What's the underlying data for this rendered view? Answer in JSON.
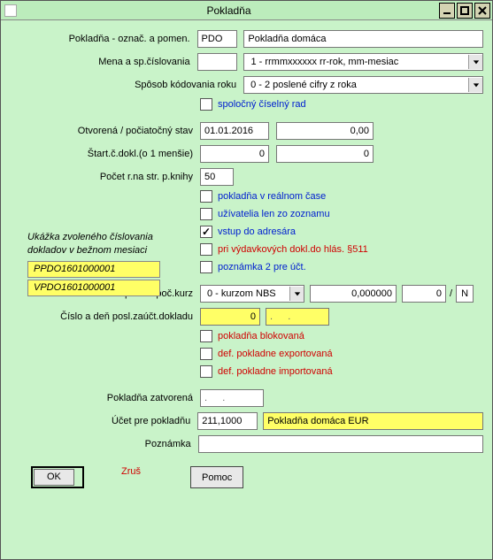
{
  "window": {
    "title": "Pokladňa"
  },
  "labels": {
    "oznac": "Pokladňa - označ. a pomen.",
    "mena": "Mena a sp.číslovania",
    "sposob": "Spôsob kódovania roku",
    "spolocny": "spoločný číselný rad",
    "otvorena": "Otvorená / počiatočný stav",
    "startc": "Štart.č.dokl.(o 1 menšie)",
    "pocetr": "Počet r.na str. p.knihy",
    "realcas": "pokladňa v reálnom čase",
    "uziv": "užívatelia len zo zoznamu",
    "vstup": "vstup do adresára",
    "vydavk": "pri výdavkových dokl.do hlás. §511",
    "pozn2": "poznámka 2 pre účt.",
    "uctovania": "Účtovania val.pokl. a poč.kurz",
    "cisloaden": "Číslo a deň posl.zaúčt.dokladu",
    "blokovana": "pokladňa blokovaná",
    "exportovana": "def. pokladne exportovaná",
    "importovana": "def. pokladne importovaná",
    "zatvorena": "Pokladňa zatvorená",
    "ucetpre": "Účet pre pokladňu",
    "poznamka": "Poznámka",
    "preview_title": "Ukážka zvoleného číslovania dokladov v bežnom mesiaci"
  },
  "values": {
    "code": "PDO",
    "name": "Pokladňa domáca",
    "mena": "",
    "mena_sel": "1 - rrmmxxxxxx   rr-rok, mm-mesiac",
    "sposob_sel": "0 - 2 poslené cifry z roka",
    "otvorena_date": "01.01.2016",
    "otvorena_amt": "0,00",
    "start1": "0",
    "start2": "0",
    "pocetr": "50",
    "kurz_sel": "0 - kurzom NBS",
    "kurz_amt": "0,000000",
    "kurz_amt2": "0",
    "kurz_N": "N",
    "posl_cislo": "0",
    "posl_date": ".   .",
    "zatv_date": ".   .",
    "ucet": "211,1000",
    "ucet_name": "Pokladňa domáca EUR",
    "poznamka": "",
    "prev1": "PPDO1601000001",
    "prev2": "VPDO1601000001"
  },
  "checks": {
    "spolocny": false,
    "realcas": false,
    "uziv": false,
    "vstup": true,
    "vydavk": false,
    "pozn2": false,
    "blokovana": false,
    "exportovana": false,
    "importovana": false
  },
  "buttons": {
    "ok": "OK",
    "zrus": "Zruš",
    "pomoc": "Pomoc"
  }
}
